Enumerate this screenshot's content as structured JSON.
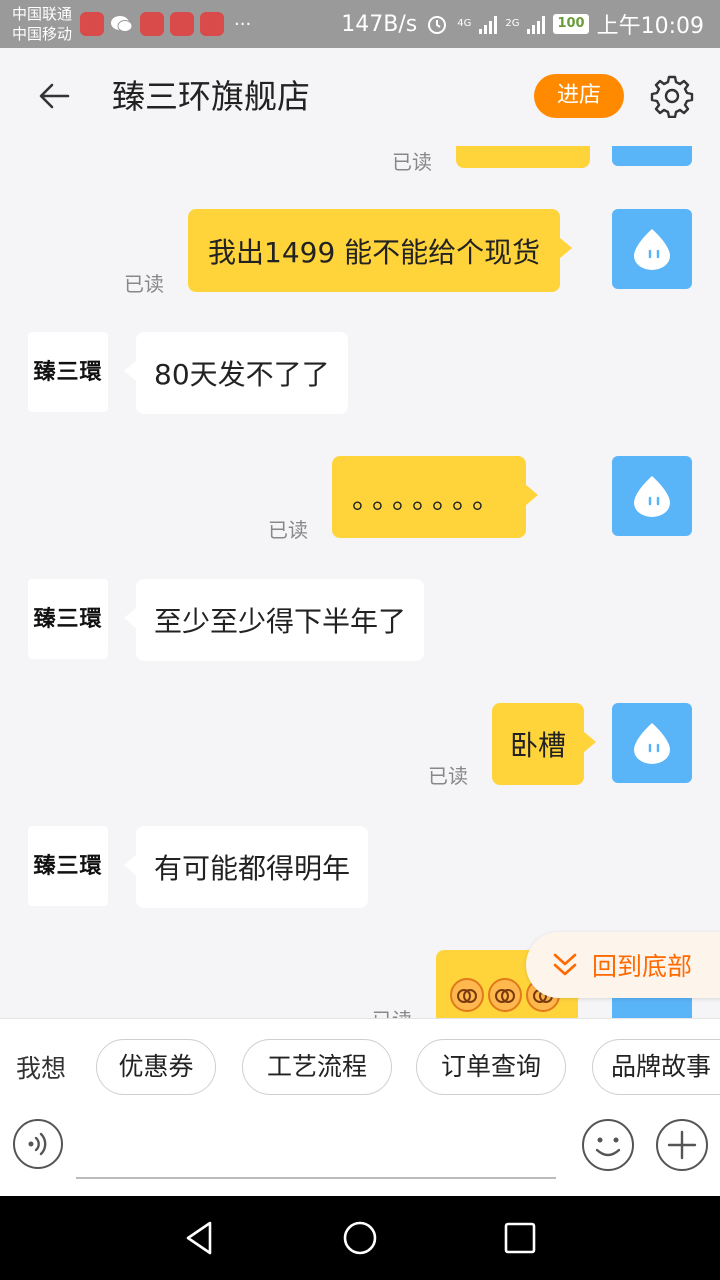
{
  "status_bar": {
    "carrier1": "中国联通",
    "carrier2": "中国移动",
    "speed": "147B/s",
    "net1": "4G",
    "net2": "2G",
    "battery": "100",
    "time": "上午10:09"
  },
  "header": {
    "title": "臻三环旗舰店",
    "enter_label": "进店"
  },
  "shop": {
    "avatar_text": "臻三環"
  },
  "messages": [
    {
      "from": "me",
      "text": "我出1499 能不能给个现货",
      "read": "已读"
    },
    {
      "from": "shop",
      "text": "80天发不了了"
    },
    {
      "from": "me",
      "text": "。。。。。。。",
      "read": "已读"
    },
    {
      "from": "shop",
      "text": "至少至少得下半年了"
    },
    {
      "from": "me",
      "text": "卧槽",
      "read": "已读"
    },
    {
      "from": "shop",
      "text": "有可能都得明年"
    }
  ],
  "partial_top_read": "已读",
  "partial_bottom_read": "已读",
  "back_to_bottom": "回到底部",
  "quick": {
    "label": "我想",
    "chips": [
      "优惠券",
      "工艺流程",
      "订单查询",
      "品牌故事"
    ]
  },
  "colors": {
    "accent": "#ff8a00",
    "my_bubble": "#ffd43b",
    "my_avatar": "#5ab4f8"
  }
}
